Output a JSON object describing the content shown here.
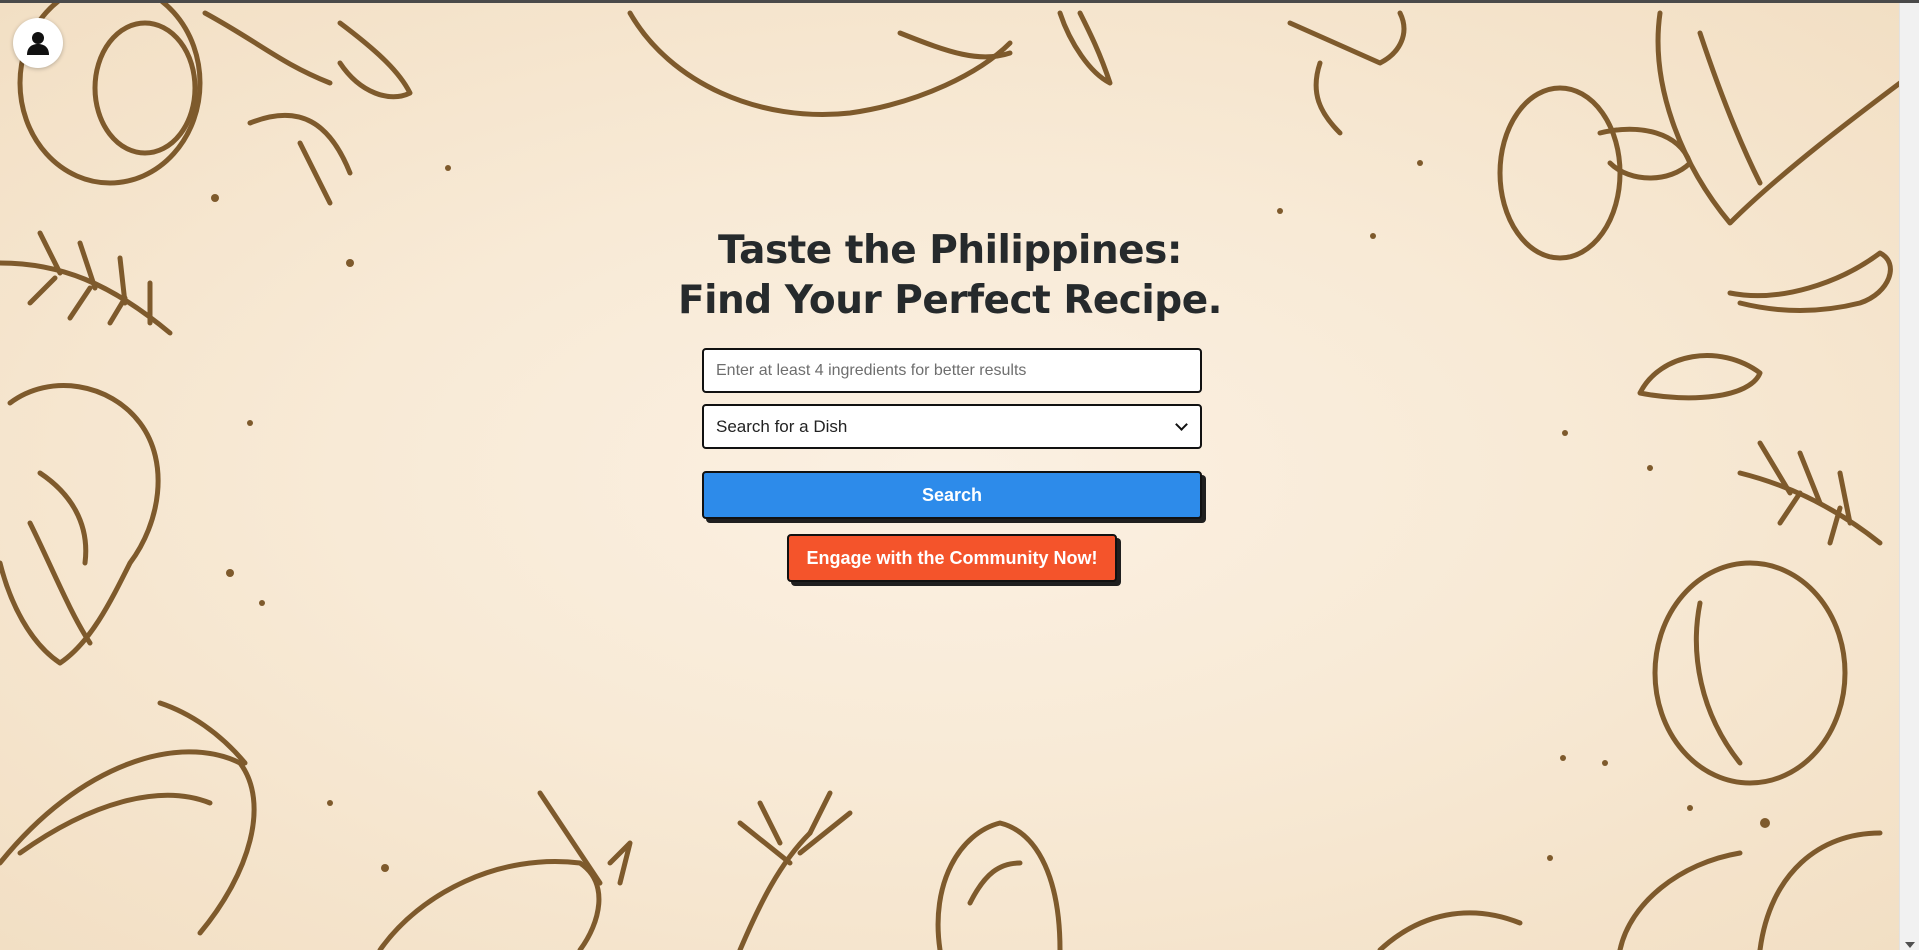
{
  "header": {
    "avatar_icon": "user-avatar-icon"
  },
  "hero": {
    "title_line1": "Taste the Philippines:",
    "title_line2": "Find Your Perfect Recipe."
  },
  "search_form": {
    "ingredients_placeholder": "Enter at least 4 ingredients for better results",
    "ingredients_value": "",
    "dish_select_value": "Search for a Dish",
    "search_label": "Search"
  },
  "community": {
    "button_label": "Engage with the Community Now!"
  },
  "colors": {
    "background": "#f7e8d3",
    "sketch_ink": "#7e5a2c",
    "search_button": "#2d8bea",
    "community_button": "#f4542b",
    "title_text": "#262a2c"
  }
}
